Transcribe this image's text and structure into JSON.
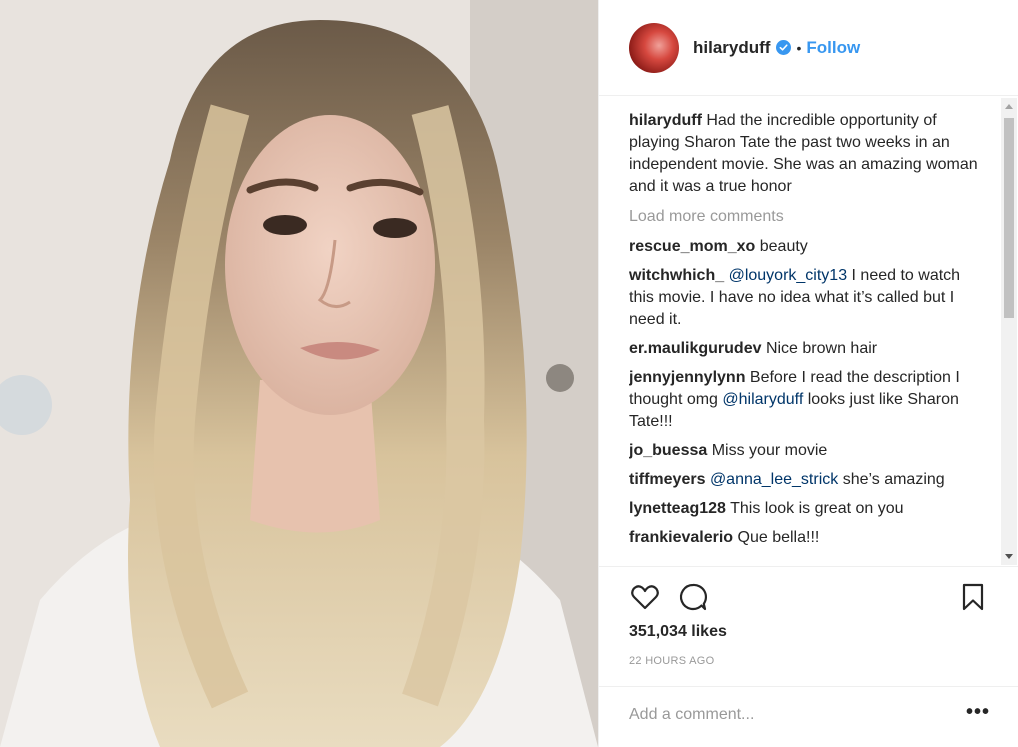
{
  "post": {
    "username": "hilaryduff",
    "separator": "•",
    "follow_label": "Follow",
    "caption_user": "hilaryduff",
    "caption_text": " Had the incredible opportunity of playing Sharon Tate the past two weeks in an independent movie. She was an amazing woman and it was a true honor",
    "load_more": "Load more comments",
    "likes": "351,034 likes",
    "timestamp": "22 HOURS AGO",
    "add_comment_placeholder": "Add a comment...",
    "more_label": "•••"
  },
  "comments": [
    {
      "user": "rescue_mom_xo",
      "pre": "",
      "mention": "",
      "text": " beauty"
    },
    {
      "user": "witchwhich_",
      "pre": " ",
      "mention": "@louyork_city13",
      "text": " I need to watch this movie. I have no idea what it’s called but I need it."
    },
    {
      "user": "er.maulikgurudev",
      "pre": "",
      "mention": "",
      "text": " Nice brown hair"
    },
    {
      "user": "jennyjennylynn",
      "pre": " Before I read the description I thought omg ",
      "mention": "@hilaryduff",
      "text": " looks just like Sharon Tate!!!"
    },
    {
      "user": "jo_buessa",
      "pre": "",
      "mention": "",
      "text": " Miss your movie"
    },
    {
      "user": "tiffmeyers",
      "pre": " ",
      "mention": "@anna_lee_strick",
      "text": " she’s amazing"
    },
    {
      "user": "lynetteag128",
      "pre": "",
      "mention": "",
      "text": " This look is great on you"
    },
    {
      "user": "frankievalerio",
      "pre": "",
      "mention": "",
      "text": " Que bella!!!"
    }
  ],
  "colors": {
    "accent": "#3897f0",
    "mention": "#003569",
    "muted": "#999999",
    "text": "#262626"
  },
  "icons": {
    "verified": "verified-badge-icon",
    "like": "heart-icon",
    "comment": "speech-bubble-icon",
    "save": "bookmark-icon",
    "more": "ellipsis-icon"
  }
}
